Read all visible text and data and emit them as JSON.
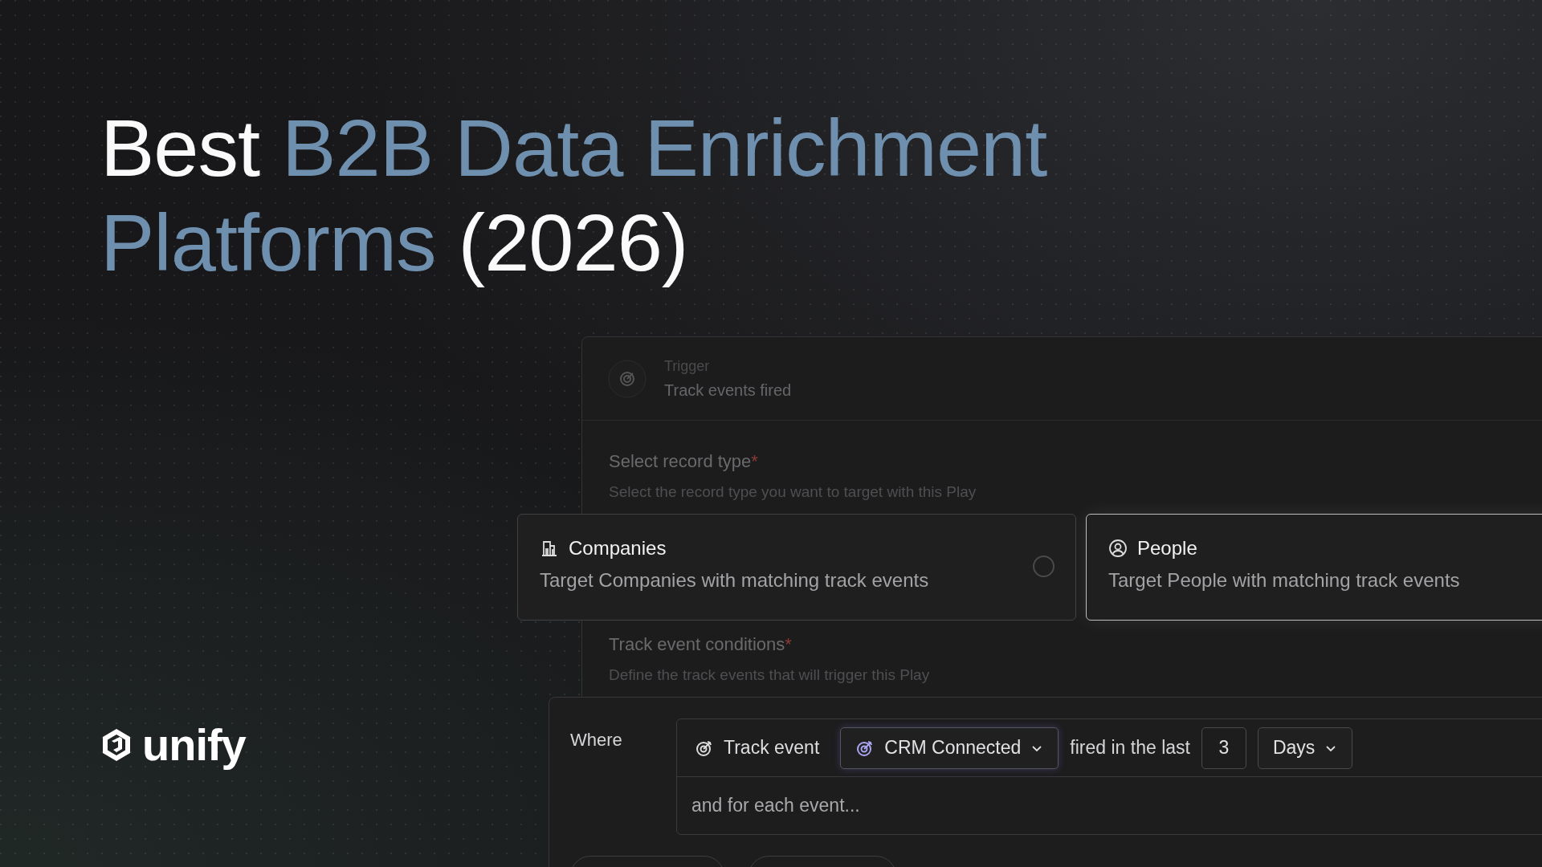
{
  "headline": {
    "lines": [
      [
        {
          "text": "Best",
          "accent": false
        },
        {
          "text": "B2B Data Enrichment",
          "accent": true
        }
      ],
      [
        {
          "text": "Platforms",
          "accent": true
        },
        {
          "text": "(2026)",
          "accent": false
        }
      ]
    ]
  },
  "logo": {
    "name": "unify"
  },
  "panel": {
    "trigger": {
      "label": "Trigger",
      "value": "Track events fired"
    },
    "record_type": {
      "label": "Select record type",
      "required_mark": "*",
      "hint": "Select the record type you want to target with this Play"
    },
    "options": [
      {
        "kind": "building",
        "title": "Companies",
        "description": "Target Companies with matching track events",
        "selected": false
      },
      {
        "kind": "person",
        "title": "People",
        "description": "Target People with matching track events",
        "selected": true
      }
    ],
    "conditions": {
      "label": "Track event conditions",
      "required_mark": "*",
      "hint": "Define the track events that will trigger this Play"
    },
    "where": {
      "label": "Where",
      "event_chip": "Track event",
      "event_select": "CRM Connected",
      "connector": "fired in the last",
      "number": "3",
      "unit": "Days",
      "footer": "and for each event..."
    }
  }
}
